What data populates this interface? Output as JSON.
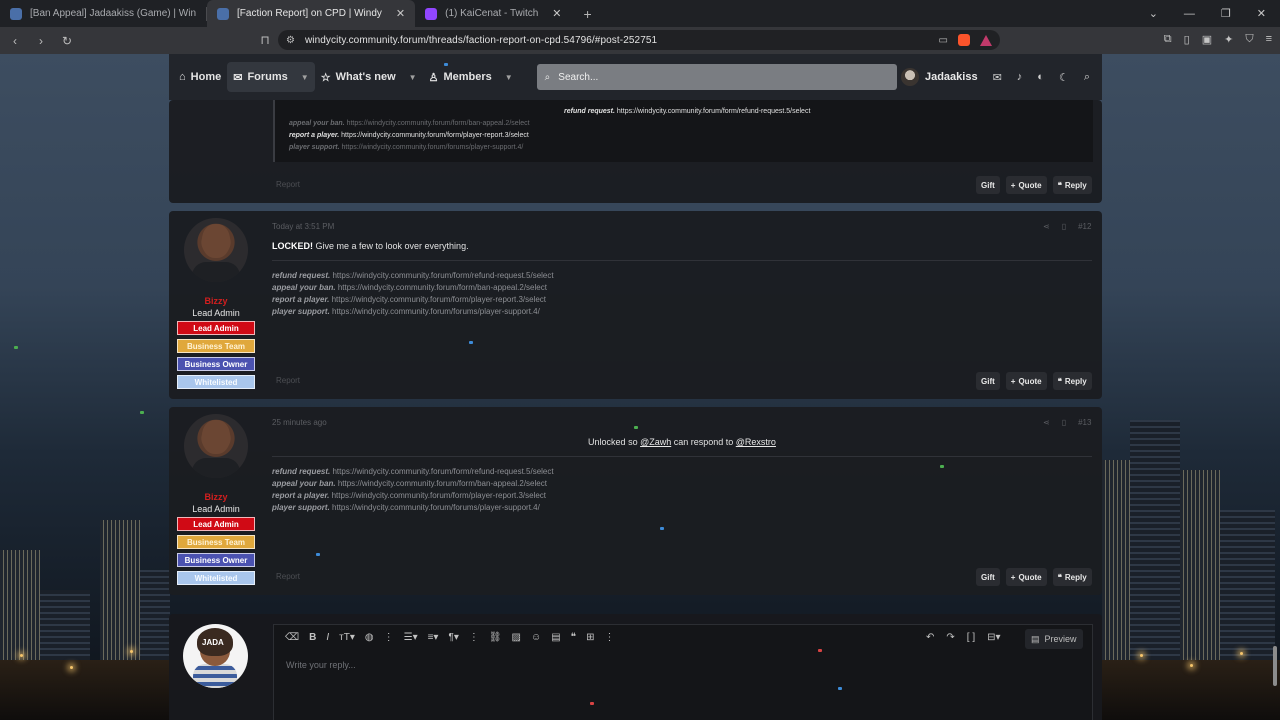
{
  "browser": {
    "tabs": [
      {
        "title": "[Ban Appeal] Jadaakiss (Game) | Win"
      },
      {
        "title": "[Faction Report] on CPD | Windy"
      },
      {
        "title": "(1) KaiCenat - Twitch"
      }
    ],
    "url": "windycity.community.forum/threads/faction-report-on-cpd.54796/#post-252751"
  },
  "nav": {
    "home": "Home",
    "forums": "Forums",
    "whats_new": "What's new",
    "members": "Members",
    "search_placeholder": "Search...",
    "username": "Jadaakiss"
  },
  "post_prev": {
    "quote_lines": [
      {
        "label": "refund request.",
        "url": "https://windycity.community.forum/form/refund-request.5/select"
      },
      {
        "label": "appeal your ban.",
        "url": "https://windycity.community.forum/form/ban-appeal.2/select"
      },
      {
        "label": "report a player.",
        "url": "https://windycity.community.forum/form/player-report.3/select"
      },
      {
        "label": "player support.",
        "url": "https://windycity.community.forum/forums/player-support.4/"
      }
    ],
    "report": "Report",
    "actions": {
      "gift": "Gift",
      "quote": "Quote",
      "reply": "Reply"
    }
  },
  "post_12": {
    "time": "Today at 3:51 PM",
    "number": "#12",
    "author": "Bizzy",
    "title": "Lead Admin",
    "badges": [
      "Lead Admin",
      "Business Team",
      "Business Owner",
      "Whitelisted"
    ],
    "body_bold": "LOCKED!",
    "body_rest": " Give me a few to look over everything.",
    "signature": [
      {
        "label": "refund request.",
        "url": "https://windycity.community.forum/form/refund-request.5/select"
      },
      {
        "label": "appeal your ban.",
        "url": "https://windycity.community.forum/form/ban-appeal.2/select"
      },
      {
        "label": "report a player.",
        "url": "https://windycity.community.forum/form/player-report.3/select"
      },
      {
        "label": "player support.",
        "url": "https://windycity.community.forum/forums/player-support.4/"
      }
    ],
    "report": "Report",
    "actions": {
      "gift": "Gift",
      "quote": "Quote",
      "reply": "Reply"
    }
  },
  "post_13": {
    "time": "25 minutes ago",
    "number": "#13",
    "author": "Bizzy",
    "title": "Lead Admin",
    "badges": [
      "Lead Admin",
      "Business Team",
      "Business Owner",
      "Whitelisted"
    ],
    "body_pre": "Unlocked so ",
    "mention1": "@Zawh",
    "body_mid": " can respond to ",
    "mention2": "@Rexstro",
    "signature": [
      {
        "label": "refund request.",
        "url": "https://windycity.community.forum/form/refund-request.5/select"
      },
      {
        "label": "appeal your ban.",
        "url": "https://windycity.community.forum/form/ban-appeal.2/select"
      },
      {
        "label": "report a player.",
        "url": "https://windycity.community.forum/form/player-report.3/select"
      },
      {
        "label": "player support.",
        "url": "https://windycity.community.forum/forums/player-support.4/"
      }
    ],
    "report": "Report",
    "actions": {
      "gift": "Gift",
      "quote": "Quote",
      "reply": "Reply"
    }
  },
  "editor": {
    "placeholder": "Write your reply...",
    "preview": "Preview",
    "avatar_tag": "JADA"
  },
  "colors": {
    "accent_red": "#d00a15",
    "badge_gold": "#e0a83c",
    "badge_blue": "#4b52b0",
    "badge_light": "#a9c6ec",
    "username_red": "#d21f1f"
  }
}
